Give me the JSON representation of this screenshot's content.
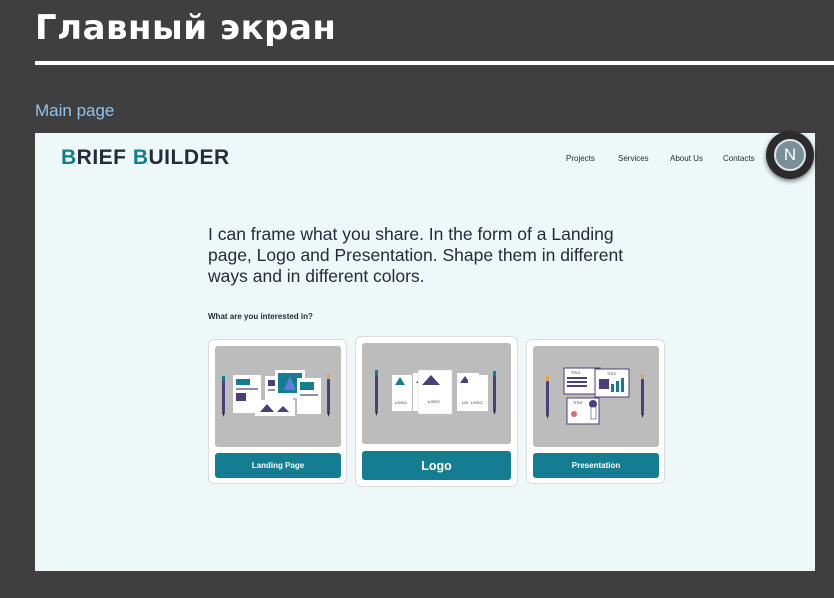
{
  "slide": {
    "title": "Главный экран",
    "frame_label": "Main page"
  },
  "site": {
    "logo": {
      "first_initial": "B",
      "first_rest": "RIEF ",
      "second_initial": "B",
      "second_rest": "UILDER"
    },
    "nav": {
      "projects": "Projects",
      "services": "Services",
      "about": "About Us",
      "contacts": "Contacts"
    },
    "hero_text": "I can frame what you share. In the form of a Landing page, Logo and Presentation. Shape them in different ways and in different colors.",
    "question": "What are you interested in?",
    "cards": [
      {
        "label": "Landing Page",
        "illustration": "landing-page-illustration"
      },
      {
        "label": "Logo",
        "illustration": "logo-illustration"
      },
      {
        "label": "Presentation",
        "illustration": "presentation-illustration"
      }
    ],
    "logo_card_tags": [
      "LOGO",
      "LOGO",
      "LOGO",
      "LOGO"
    ],
    "presentation_card_tags": [
      "TITLE",
      "TITLE",
      "TITLE"
    ]
  },
  "user": {
    "avatar_initial": "N"
  },
  "colors": {
    "background": "#3f3f3f",
    "frame_background": "#eef8f8",
    "accent": "#147d91",
    "text_dark": "#252b38",
    "frame_label": "#8fc3ee",
    "preview_gray": "#bcbcbc"
  }
}
